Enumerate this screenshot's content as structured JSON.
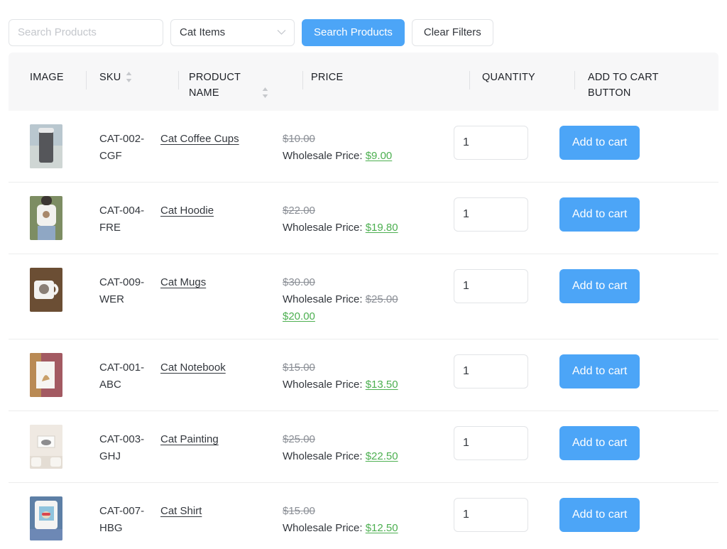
{
  "filter_bar": {
    "search_placeholder": "Search Products",
    "search_value": "",
    "category_selected": "Cat Items",
    "category_options": [
      "Cat Items"
    ],
    "search_button_label": "Search Products",
    "clear_button_label": "Clear Filters",
    "chevron_icon": "chevron-down-icon"
  },
  "colors": {
    "primary": "#4ca5f7",
    "discount_green": "#4caf50",
    "muted_gray": "#8b8f96",
    "header_bg": "#f7f7f8",
    "border": "#e2e4e7"
  },
  "table": {
    "columns": [
      {
        "label": "IMAGE",
        "sortable": false
      },
      {
        "label": "SKU",
        "sortable": true,
        "sort_icon": "sort-arrows-icon"
      },
      {
        "label": "PRODUCT NAME",
        "sortable": true,
        "sort_icon": "sort-arrows-icon"
      },
      {
        "label": "PRICE",
        "sortable": false
      },
      {
        "label": "QUANTITY",
        "sortable": false
      },
      {
        "label": "ADD TO CART BUTTON",
        "sortable": false
      }
    ],
    "wholesale_label": "Wholesale Price:",
    "add_to_cart_label": "Add to cart",
    "rows": [
      {
        "image_alt": "cat-coffee-cup-thumbnail",
        "sku": "CAT-002-CGF",
        "name": "Cat Coffee Cups",
        "price_original": "$10.00",
        "wholesale_struck": null,
        "wholesale_final": "$9.00",
        "quantity": "1"
      },
      {
        "image_alt": "cat-hoodie-thumbnail",
        "sku": "CAT-004-FRE",
        "name": "Cat Hoodie",
        "price_original": "$22.00",
        "wholesale_struck": null,
        "wholesale_final": "$19.80",
        "quantity": "1"
      },
      {
        "image_alt": "cat-mug-thumbnail",
        "sku": "CAT-009-WER",
        "name": "Cat Mugs",
        "price_original": "$30.00",
        "wholesale_struck": "$25.00",
        "wholesale_final": "$20.00",
        "quantity": "1"
      },
      {
        "image_alt": "cat-notebook-thumbnail",
        "sku": "CAT-001-ABC",
        "name": "Cat Notebook",
        "price_original": "$15.00",
        "wholesale_struck": null,
        "wholesale_final": "$13.50",
        "quantity": "1"
      },
      {
        "image_alt": "cat-painting-thumbnail",
        "sku": "CAT-003-GHJ",
        "name": "Cat Painting",
        "price_original": "$25.00",
        "wholesale_struck": null,
        "wholesale_final": "$22.50",
        "quantity": "1"
      },
      {
        "image_alt": "cat-shirt-thumbnail",
        "sku": "CAT-007-HBG",
        "name": "Cat Shirt",
        "price_original": "$15.00",
        "wholesale_struck": null,
        "wholesale_final": "$12.50",
        "quantity": "1"
      }
    ]
  }
}
